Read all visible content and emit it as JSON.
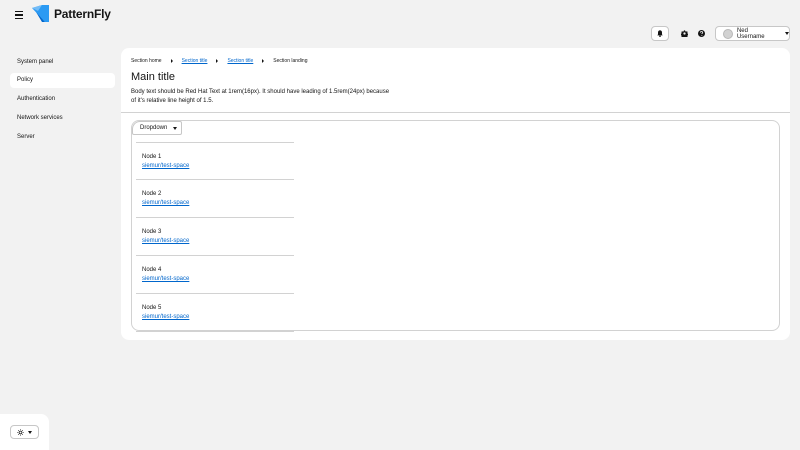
{
  "header": {
    "brand": "PatternFly",
    "user_name": "Ned Username"
  },
  "sidebar": {
    "items": [
      {
        "label": "System panel",
        "active": false
      },
      {
        "label": "Policy",
        "active": true
      },
      {
        "label": "Authentication",
        "active": false
      },
      {
        "label": "Network services",
        "active": false
      },
      {
        "label": "Server",
        "active": false
      }
    ]
  },
  "breadcrumb": [
    "Section home",
    "Section title",
    "Section title",
    "Section landing"
  ],
  "main": {
    "title": "Main title",
    "body": "Body text should be Red Hat Text at 1rem(16px). It should have leading of 1.5rem(24px) because of it's relative line height of 1.5."
  },
  "dropdown": {
    "label": "Dropdown"
  },
  "nodes": [
    {
      "name": "Node 1",
      "link": "siemur/test-space"
    },
    {
      "name": "Node 2",
      "link": "siemur/test-space"
    },
    {
      "name": "Node 3",
      "link": "siemur/test-space"
    },
    {
      "name": "Node 4",
      "link": "siemur/test-space"
    },
    {
      "name": "Node 5",
      "link": "siemur/test-space"
    }
  ],
  "colors": {
    "background": "#f2f2f2",
    "surface": "#ffffff",
    "link": "#0066cc",
    "logo_blue": "#2b9af3"
  },
  "icons": [
    "menu-icon",
    "patternfly-logo-icon",
    "bell-icon",
    "gear-icon",
    "help-icon",
    "avatar",
    "caret-down-icon",
    "sun-icon",
    "chevron-right-icon"
  ]
}
